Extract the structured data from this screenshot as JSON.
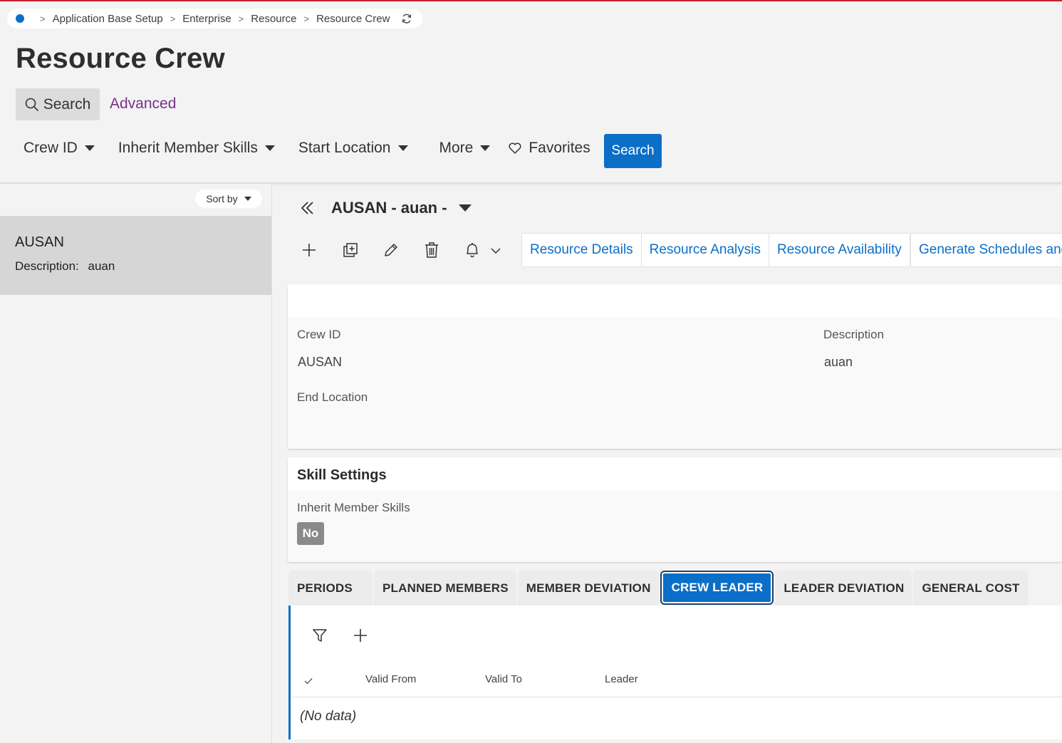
{
  "breadcrumb": {
    "items": [
      "Application Base Setup",
      "Enterprise",
      "Resource",
      "Resource Crew"
    ]
  },
  "page_title": "Resource Crew",
  "search_area": {
    "search_tab_label": "Search",
    "advanced_tab_label": "Advanced",
    "filters": [
      "Crew ID",
      "Inherit Member Skills",
      "Start Location",
      "More"
    ],
    "favorites_label": "Favorites",
    "search_button_label": "Search"
  },
  "list_panel": {
    "sort_label": "Sort by",
    "items": [
      {
        "id": "AUSAN",
        "description_label": "Description:",
        "description": "auan"
      }
    ]
  },
  "detail": {
    "record_title": "AUSAN - auan -",
    "links": [
      "Resource Details",
      "Resource Analysis",
      "Resource Availability",
      "Generate Schedules and"
    ],
    "crew_id_label": "Crew ID",
    "crew_id_value": "AUSAN",
    "description_label": "Description",
    "description_value": "auan",
    "end_location_label": "End Location",
    "skill_settings": {
      "title": "Skill Settings",
      "inherit_label": "Inherit Member Skills",
      "inherit_value": "No"
    }
  },
  "tabs": {
    "items": [
      "PERIODS",
      "PLANNED MEMBERS",
      "MEMBER DEVIATION",
      "CREW LEADER",
      "LEADER DEVIATION",
      "GENERAL COST"
    ],
    "active": "CREW LEADER"
  },
  "grid": {
    "columns": [
      "Valid From",
      "Valid To",
      "Leader"
    ],
    "empty_text": "(No data)"
  },
  "colors": {
    "accent": "#0b6fc8",
    "advanced_link": "#7a2f89",
    "top_bar": "#c8202f"
  }
}
